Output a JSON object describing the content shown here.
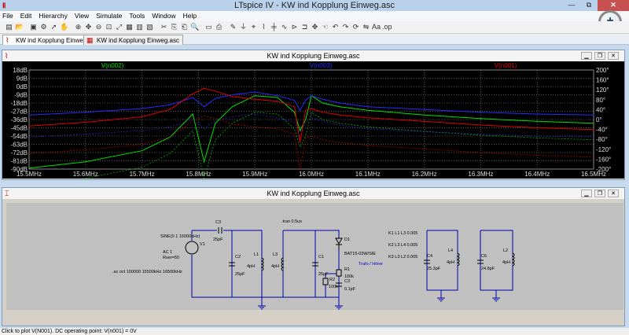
{
  "window": {
    "title": "LTspice IV - KW ind Kopplung Einweg.asc",
    "min": "—",
    "max": "⧉",
    "close": "✕"
  },
  "menu": [
    "File",
    "Edit",
    "Hierarchy",
    "View",
    "Simulate",
    "Tools",
    "Window",
    "Help"
  ],
  "tabs": [
    {
      "label": "KW ind Kopplung Einweg.asc",
      "icon": "waveform-icon"
    },
    {
      "label": "KW ind Kopplung Einweg.asc",
      "icon": "schematic-icon"
    }
  ],
  "toolbar_icons": [
    "new-schematic-icon",
    "open-icon",
    "save-icon",
    "control-panel-icon",
    "run-icon",
    "halt-icon",
    "zoom-in-icon",
    "pan-icon",
    "zoom-out-icon",
    "zoom-fit-icon",
    "autorange-icon",
    "grid-icon",
    "tile-icon",
    "cascade-icon",
    "cut-icon",
    "copy-icon",
    "paste-icon",
    "find-icon",
    "print-setup-icon",
    "print-icon",
    "draw-wire-icon",
    "ground-icon",
    "label-net-icon",
    "resistor-icon",
    "capacitor-icon",
    "inductor-icon",
    "diode-icon",
    "component-icon",
    "move-icon",
    "drag-icon",
    "undo-icon",
    "redo-icon",
    "rotate-icon",
    "mirror-icon",
    "text-icon",
    "spice-directive-icon"
  ],
  "waveform_window": {
    "title": "KW ind Kopplung Einweg.asc",
    "traces": [
      {
        "label": "V(n002)",
        "color": "#00e000"
      },
      {
        "label": "V(n003)",
        "color": "#2a2aff"
      },
      {
        "label": "V(n001)",
        "color": "#e00000"
      }
    ],
    "left_ticks": [
      "18dB",
      "9dB",
      "0dB",
      "-9dB",
      "-18dB",
      "-27dB",
      "-36dB",
      "-45dB",
      "-54dB",
      "-63dB",
      "-72dB",
      "-81dB",
      "-90dB"
    ],
    "right_ticks": [
      "200°",
      "160°",
      "120°",
      "80°",
      "40°",
      "0°",
      "-40°",
      "-80°",
      "-120°",
      "-160°",
      "-200°"
    ],
    "x_ticks": [
      "15.5MHz",
      "15.6MHz",
      "15.7MHz",
      "15.8MHz",
      "15.9MHz",
      "16.0MHz",
      "16.1MHz",
      "16.2MHz",
      "16.3MHz",
      "16.4MHz",
      "16.5MHz"
    ]
  },
  "chart_data": {
    "type": "line",
    "x_unit": "MHz",
    "xlim": [
      15.5,
      16.5
    ],
    "ylim": [
      -90,
      18
    ],
    "y_unit": "dB",
    "y2lim": [
      -200,
      200
    ],
    "y2_unit": "°",
    "series": [
      {
        "name": "V(n002)",
        "color": "#00e000",
        "x": [
          15.5,
          15.6,
          15.7,
          15.75,
          15.79,
          15.81,
          15.83,
          15.86,
          15.9,
          15.94,
          15.97,
          15.98,
          15.99,
          16.0,
          16.02,
          16.05,
          16.1,
          16.2,
          16.3,
          16.4,
          16.5
        ],
        "y": [
          -89,
          -82,
          -70,
          -55,
          -30,
          -82,
          -40,
          -22,
          -10,
          -12,
          -28,
          -48,
          -36,
          -10,
          -18,
          -22,
          -26,
          -31,
          -35,
          -38,
          -40
        ]
      },
      {
        "name": "V(n003)",
        "color": "#2a2aff",
        "x": [
          15.5,
          15.6,
          15.7,
          15.75,
          15.79,
          15.81,
          15.83,
          15.86,
          15.9,
          15.94,
          15.97,
          15.98,
          15.99,
          16.0,
          16.02,
          16.05,
          16.1,
          16.2,
          16.3,
          16.4,
          16.5
        ],
        "y": [
          -31,
          -28,
          -24,
          -20,
          -12,
          -22,
          -13,
          -9,
          -6,
          -10,
          -15,
          -26,
          -15,
          -10,
          -14,
          -18,
          -22,
          -25,
          -28,
          -30,
          -31
        ]
      },
      {
        "name": "V(n001)",
        "color": "#e00000",
        "x": [
          15.5,
          15.6,
          15.7,
          15.75,
          15.79,
          15.81,
          15.83,
          15.86,
          15.9,
          15.94,
          15.97,
          15.98,
          15.99,
          16.0,
          16.02,
          16.05,
          16.1,
          16.2,
          16.3,
          16.4,
          16.5
        ],
        "y": [
          -43,
          -39,
          -33,
          -25,
          -8,
          -2,
          -5,
          -11,
          -14,
          -16,
          -22,
          -61,
          -26,
          -24,
          -28,
          -31,
          -34,
          -38,
          -42,
          -45,
          -47
        ]
      }
    ]
  },
  "schematic_window": {
    "title": "KW ind Kopplung Einweg.asc",
    "labels": {
      "tran": ".tran 0.5us",
      "source": "SINE(0 1 16000kHz)",
      "v1": "V1",
      "ac": "AC 1",
      "rser": "Rser=50",
      "ac_cmd": ".ac oct 100000 15500kHz 16500kHz",
      "c3_top": "C3",
      "c3_top_val": "25pF",
      "c2": "C2",
      "c2_val": "25pF",
      "l1": "L1",
      "l1_val": "4pH",
      "l3": "L3",
      "l3_val": "4pH",
      "c1": "C1",
      "c1_val": "25pF",
      "d1": "D1",
      "d1_val": "BAT15-03W/SIE",
      "r1": "R1",
      "r1_val": "100k",
      "r2": "R2",
      "r2_val": "100k",
      "c3_bot": "C3",
      "c3_bot_val": "0.1pF",
      "trafo": "Trafo / Hörer",
      "k1": "K1 L1 L3 0.005",
      "k2": "K2 L3 L4 0.005",
      "k3": "K3 L3 L2 0.005",
      "c4": "C4",
      "c4_val": "25.3pF",
      "l4": "L4",
      "l4_val": "4pH",
      "c6": "C6",
      "c6_val": "24.8pF",
      "l2": "L2",
      "l2_val": "4pH"
    }
  },
  "status": "Click to plot V(N001).  DC operating point: V(n001) = 0V"
}
